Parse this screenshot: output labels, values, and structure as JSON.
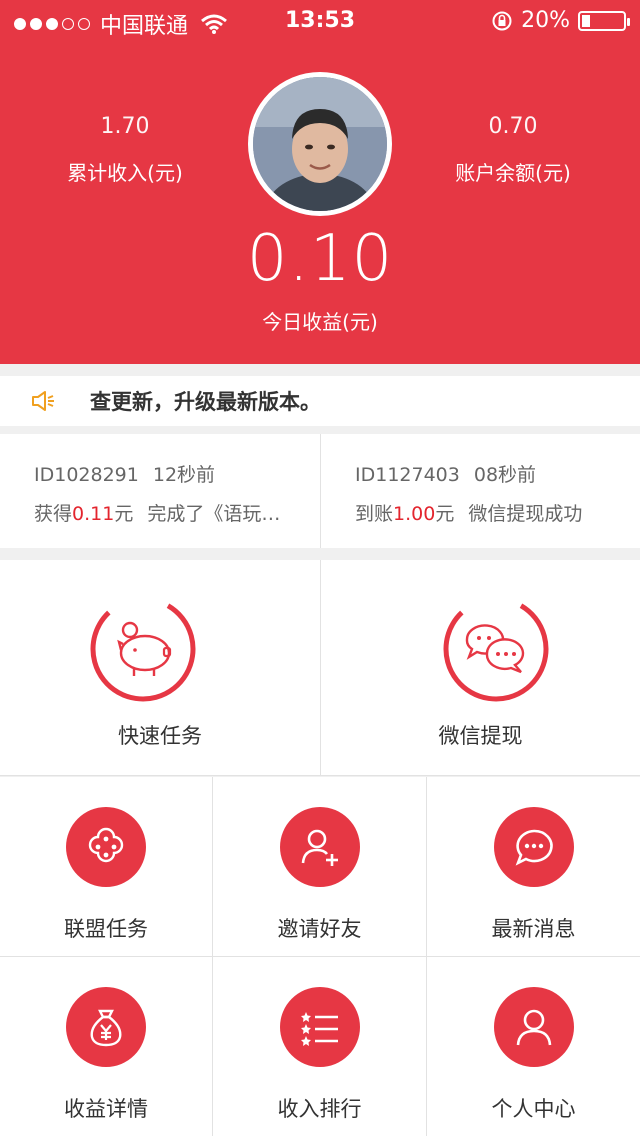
{
  "status_bar": {
    "carrier": "中国联通",
    "time": "13:53",
    "battery": "20%"
  },
  "summary": {
    "total_income_value": "1.70",
    "total_income_label": "累计收入(元)",
    "balance_value": "0.70",
    "balance_label": "账户余额(元)",
    "today_value": "0.10",
    "today_label": "今日收益(元)"
  },
  "notice": {
    "text": "查更新，升级最新版本。"
  },
  "feed": [
    {
      "id": "ID1028291",
      "time": "12秒前",
      "prefix": "获得",
      "amount": "0.11",
      "unit": "元",
      "desc": "完成了《语玩…"
    },
    {
      "id": "ID1127403",
      "time": "08秒前",
      "prefix": "到账",
      "amount": "1.00",
      "unit": "元",
      "desc": "微信提现成功"
    }
  ],
  "main_actions": [
    {
      "label": "快速任务",
      "icon": "piggy-bank-icon"
    },
    {
      "label": "微信提现",
      "icon": "wechat-icon"
    }
  ],
  "grid": [
    {
      "label": "联盟任务",
      "icon": "alliance-icon"
    },
    {
      "label": "邀请好友",
      "icon": "add-user-icon"
    },
    {
      "label": "最新消息",
      "icon": "message-icon"
    },
    {
      "label": "收益详情",
      "icon": "money-bag-icon"
    },
    {
      "label": "收入排行",
      "icon": "ranking-icon"
    },
    {
      "label": "个人中心",
      "icon": "person-icon"
    }
  ],
  "colors": {
    "primary": "#e63744",
    "accent_red": "#e3252e",
    "notice_icon": "#f0a020"
  }
}
